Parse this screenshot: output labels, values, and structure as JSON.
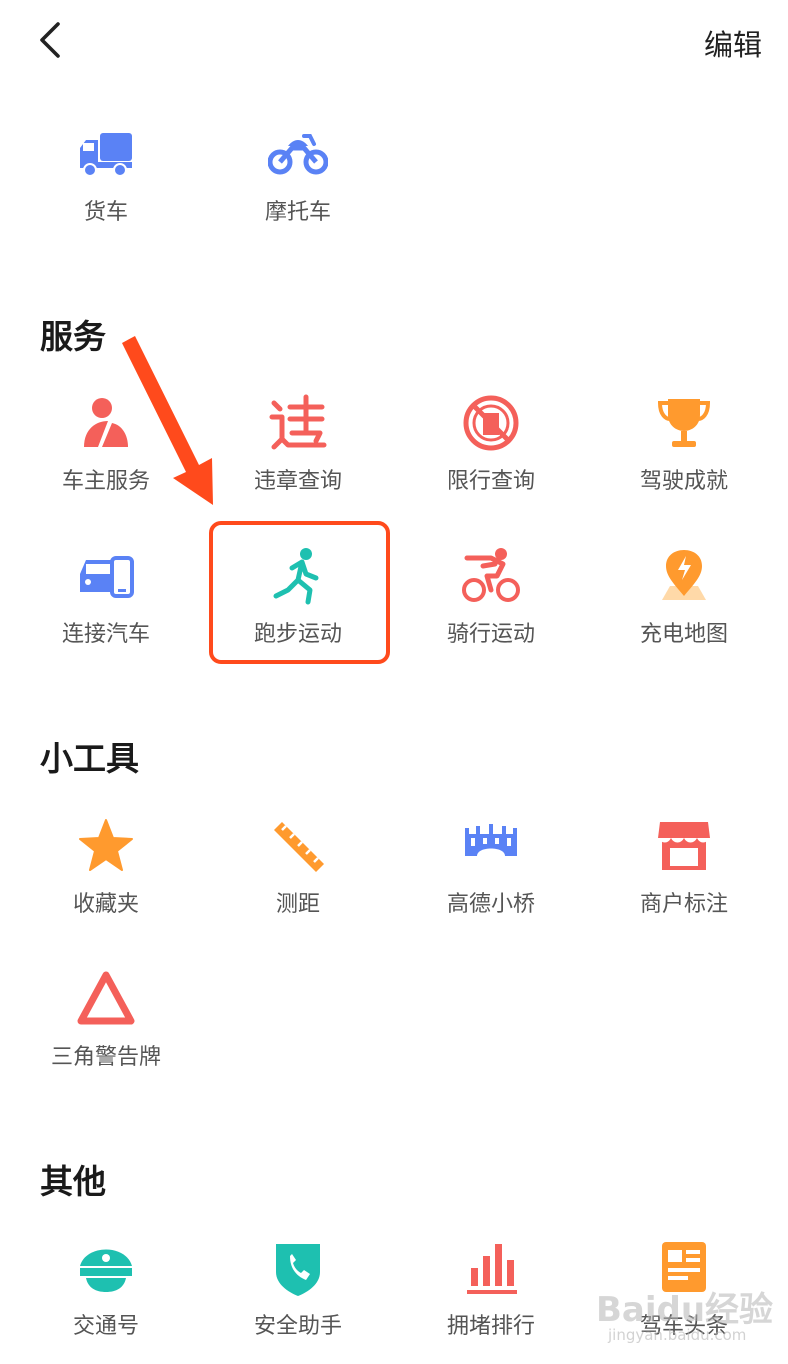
{
  "header": {
    "edit_label": "编辑"
  },
  "colors": {
    "blue": "#5a82f5",
    "red": "#f4605a",
    "orange": "#ff9a2e",
    "teal": "#1ec0b0",
    "annotation": "#ff4a1c"
  },
  "vehicles": [
    {
      "label": "货车",
      "icon": "truck-icon"
    },
    {
      "label": "摩托车",
      "icon": "motorcycle-icon"
    }
  ],
  "services": {
    "title": "服务",
    "items": [
      {
        "label": "车主服务",
        "icon": "car-owner-icon"
      },
      {
        "label": "违章查询",
        "icon": "violation-icon"
      },
      {
        "label": "限行查询",
        "icon": "restriction-icon"
      },
      {
        "label": "驾驶成就",
        "icon": "trophy-icon"
      },
      {
        "label": "连接汽车",
        "icon": "car-phone-icon"
      },
      {
        "label": "跑步运动",
        "icon": "running-icon"
      },
      {
        "label": "骑行运动",
        "icon": "cycling-icon"
      },
      {
        "label": "充电地图",
        "icon": "charging-map-icon"
      }
    ]
  },
  "tools": {
    "title": "小工具",
    "items": [
      {
        "label": "收藏夹",
        "icon": "star-icon"
      },
      {
        "label": "测距",
        "icon": "ruler-icon"
      },
      {
        "label": "高德小桥",
        "icon": "bridge-icon"
      },
      {
        "label": "商户标注",
        "icon": "shop-icon"
      },
      {
        "label": "三角警告牌",
        "icon": "warning-triangle-icon"
      }
    ]
  },
  "others": {
    "title": "其他",
    "items": [
      {
        "label": "交通号",
        "icon": "police-cap-icon"
      },
      {
        "label": "安全助手",
        "icon": "phone-shield-icon"
      },
      {
        "label": "拥堵排行",
        "icon": "bar-chart-icon"
      },
      {
        "label": "驾车头条",
        "icon": "news-icon"
      }
    ]
  },
  "watermark": {
    "main": "Baidu经验",
    "sub": "jingyan.baidu.com"
  }
}
